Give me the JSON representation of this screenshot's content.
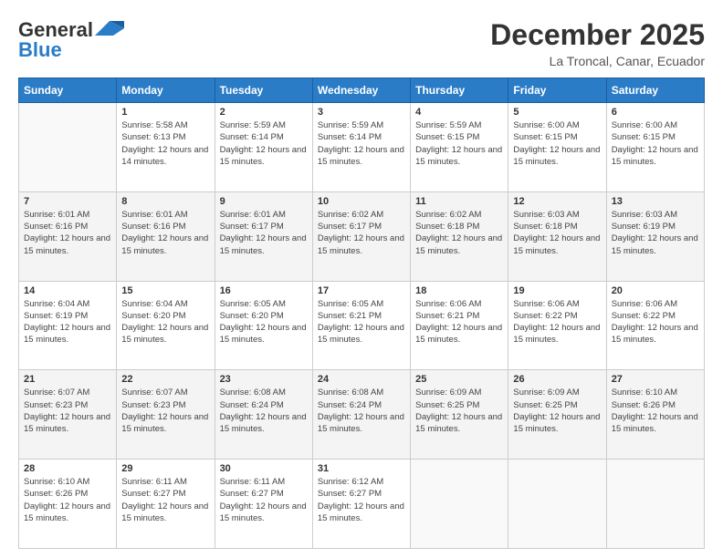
{
  "logo": {
    "line1": "General",
    "line2": "Blue"
  },
  "title": "December 2025",
  "location": "La Troncal, Canar, Ecuador",
  "days_of_week": [
    "Sunday",
    "Monday",
    "Tuesday",
    "Wednesday",
    "Thursday",
    "Friday",
    "Saturday"
  ],
  "weeks": [
    [
      {
        "num": "",
        "sunrise": "",
        "sunset": "",
        "daylight": ""
      },
      {
        "num": "1",
        "sunrise": "Sunrise: 5:58 AM",
        "sunset": "Sunset: 6:13 PM",
        "daylight": "Daylight: 12 hours and 14 minutes."
      },
      {
        "num": "2",
        "sunrise": "Sunrise: 5:59 AM",
        "sunset": "Sunset: 6:14 PM",
        "daylight": "Daylight: 12 hours and 15 minutes."
      },
      {
        "num": "3",
        "sunrise": "Sunrise: 5:59 AM",
        "sunset": "Sunset: 6:14 PM",
        "daylight": "Daylight: 12 hours and 15 minutes."
      },
      {
        "num": "4",
        "sunrise": "Sunrise: 5:59 AM",
        "sunset": "Sunset: 6:15 PM",
        "daylight": "Daylight: 12 hours and 15 minutes."
      },
      {
        "num": "5",
        "sunrise": "Sunrise: 6:00 AM",
        "sunset": "Sunset: 6:15 PM",
        "daylight": "Daylight: 12 hours and 15 minutes."
      },
      {
        "num": "6",
        "sunrise": "Sunrise: 6:00 AM",
        "sunset": "Sunset: 6:15 PM",
        "daylight": "Daylight: 12 hours and 15 minutes."
      }
    ],
    [
      {
        "num": "7",
        "sunrise": "Sunrise: 6:01 AM",
        "sunset": "Sunset: 6:16 PM",
        "daylight": "Daylight: 12 hours and 15 minutes."
      },
      {
        "num": "8",
        "sunrise": "Sunrise: 6:01 AM",
        "sunset": "Sunset: 6:16 PM",
        "daylight": "Daylight: 12 hours and 15 minutes."
      },
      {
        "num": "9",
        "sunrise": "Sunrise: 6:01 AM",
        "sunset": "Sunset: 6:17 PM",
        "daylight": "Daylight: 12 hours and 15 minutes."
      },
      {
        "num": "10",
        "sunrise": "Sunrise: 6:02 AM",
        "sunset": "Sunset: 6:17 PM",
        "daylight": "Daylight: 12 hours and 15 minutes."
      },
      {
        "num": "11",
        "sunrise": "Sunrise: 6:02 AM",
        "sunset": "Sunset: 6:18 PM",
        "daylight": "Daylight: 12 hours and 15 minutes."
      },
      {
        "num": "12",
        "sunrise": "Sunrise: 6:03 AM",
        "sunset": "Sunset: 6:18 PM",
        "daylight": "Daylight: 12 hours and 15 minutes."
      },
      {
        "num": "13",
        "sunrise": "Sunrise: 6:03 AM",
        "sunset": "Sunset: 6:19 PM",
        "daylight": "Daylight: 12 hours and 15 minutes."
      }
    ],
    [
      {
        "num": "14",
        "sunrise": "Sunrise: 6:04 AM",
        "sunset": "Sunset: 6:19 PM",
        "daylight": "Daylight: 12 hours and 15 minutes."
      },
      {
        "num": "15",
        "sunrise": "Sunrise: 6:04 AM",
        "sunset": "Sunset: 6:20 PM",
        "daylight": "Daylight: 12 hours and 15 minutes."
      },
      {
        "num": "16",
        "sunrise": "Sunrise: 6:05 AM",
        "sunset": "Sunset: 6:20 PM",
        "daylight": "Daylight: 12 hours and 15 minutes."
      },
      {
        "num": "17",
        "sunrise": "Sunrise: 6:05 AM",
        "sunset": "Sunset: 6:21 PM",
        "daylight": "Daylight: 12 hours and 15 minutes."
      },
      {
        "num": "18",
        "sunrise": "Sunrise: 6:06 AM",
        "sunset": "Sunset: 6:21 PM",
        "daylight": "Daylight: 12 hours and 15 minutes."
      },
      {
        "num": "19",
        "sunrise": "Sunrise: 6:06 AM",
        "sunset": "Sunset: 6:22 PM",
        "daylight": "Daylight: 12 hours and 15 minutes."
      },
      {
        "num": "20",
        "sunrise": "Sunrise: 6:06 AM",
        "sunset": "Sunset: 6:22 PM",
        "daylight": "Daylight: 12 hours and 15 minutes."
      }
    ],
    [
      {
        "num": "21",
        "sunrise": "Sunrise: 6:07 AM",
        "sunset": "Sunset: 6:23 PM",
        "daylight": "Daylight: 12 hours and 15 minutes."
      },
      {
        "num": "22",
        "sunrise": "Sunrise: 6:07 AM",
        "sunset": "Sunset: 6:23 PM",
        "daylight": "Daylight: 12 hours and 15 minutes."
      },
      {
        "num": "23",
        "sunrise": "Sunrise: 6:08 AM",
        "sunset": "Sunset: 6:24 PM",
        "daylight": "Daylight: 12 hours and 15 minutes."
      },
      {
        "num": "24",
        "sunrise": "Sunrise: 6:08 AM",
        "sunset": "Sunset: 6:24 PM",
        "daylight": "Daylight: 12 hours and 15 minutes."
      },
      {
        "num": "25",
        "sunrise": "Sunrise: 6:09 AM",
        "sunset": "Sunset: 6:25 PM",
        "daylight": "Daylight: 12 hours and 15 minutes."
      },
      {
        "num": "26",
        "sunrise": "Sunrise: 6:09 AM",
        "sunset": "Sunset: 6:25 PM",
        "daylight": "Daylight: 12 hours and 15 minutes."
      },
      {
        "num": "27",
        "sunrise": "Sunrise: 6:10 AM",
        "sunset": "Sunset: 6:26 PM",
        "daylight": "Daylight: 12 hours and 15 minutes."
      }
    ],
    [
      {
        "num": "28",
        "sunrise": "Sunrise: 6:10 AM",
        "sunset": "Sunset: 6:26 PM",
        "daylight": "Daylight: 12 hours and 15 minutes."
      },
      {
        "num": "29",
        "sunrise": "Sunrise: 6:11 AM",
        "sunset": "Sunset: 6:27 PM",
        "daylight": "Daylight: 12 hours and 15 minutes."
      },
      {
        "num": "30",
        "sunrise": "Sunrise: 6:11 AM",
        "sunset": "Sunset: 6:27 PM",
        "daylight": "Daylight: 12 hours and 15 minutes."
      },
      {
        "num": "31",
        "sunrise": "Sunrise: 6:12 AM",
        "sunset": "Sunset: 6:27 PM",
        "daylight": "Daylight: 12 hours and 15 minutes."
      },
      {
        "num": "",
        "sunrise": "",
        "sunset": "",
        "daylight": ""
      },
      {
        "num": "",
        "sunrise": "",
        "sunset": "",
        "daylight": ""
      },
      {
        "num": "",
        "sunrise": "",
        "sunset": "",
        "daylight": ""
      }
    ]
  ]
}
